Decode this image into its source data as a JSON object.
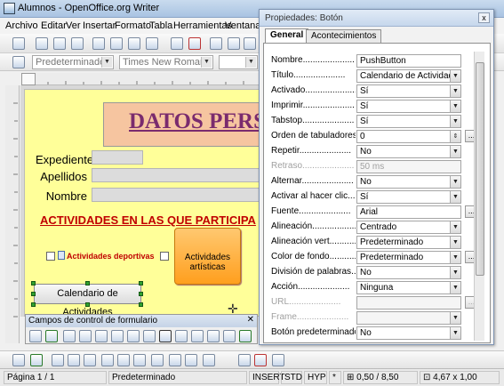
{
  "window": {
    "title": "Alumnos - OpenOffice.org Writer"
  },
  "menu": [
    "Archivo",
    "Editar",
    "Ver",
    "Insertar",
    "Formato",
    "Tabla",
    "Herramientas",
    "Ventana"
  ],
  "format_bar": {
    "style": "Predeterminado",
    "font": "Times New Roman"
  },
  "document": {
    "header": "DATOS PERSONA",
    "fields": [
      {
        "label": "Expediente"
      },
      {
        "label": "Apellidos"
      },
      {
        "label": "Nombre"
      }
    ],
    "activities_title": "ACTIVIDADES EN LAS QUE PARTICIPA",
    "checkbox_sport": "Actividades deportivas",
    "checkbox_art": "Actividades artísticas",
    "calendar_button": "Calendario de Actividades"
  },
  "form_controls_toolbar": {
    "title": "Campos de control de formulario"
  },
  "status_bar": {
    "page": "Página 1 / 1",
    "style": "Predeterminado",
    "insert": "INSERT",
    "std": "STD",
    "hyp": "HYP",
    "mod": "*",
    "position": "0,50 / 8,50",
    "size": "4,67 x 1,00"
  },
  "dialog": {
    "title": "Propiedades: Botón",
    "close": "x",
    "tabs": [
      "General",
      "Acontecimientos"
    ],
    "rows": [
      {
        "label": "Nombre",
        "value": "PushButton"
      },
      {
        "label": "Título",
        "value": "Calendario de Actividades"
      },
      {
        "label": "Activado",
        "value": "Sí"
      },
      {
        "label": "Imprimir",
        "value": "Sí"
      },
      {
        "label": "Tabstop",
        "value": "Sí"
      },
      {
        "label": "Orden de tabuladores",
        "value": "0"
      },
      {
        "label": "Repetir",
        "value": "No"
      },
      {
        "label": "Retraso",
        "value": "50 ms"
      },
      {
        "label": "Alternar",
        "value": "No"
      },
      {
        "label": "Activar al hacer clic",
        "value": "Sí"
      },
      {
        "label": "Fuente",
        "value": "Arial"
      },
      {
        "label": "Alineación",
        "value": "Centrado"
      },
      {
        "label": "Alineación vert.",
        "value": "Predeterminado"
      },
      {
        "label": "Color de fondo",
        "value": "Predeterminado"
      },
      {
        "label": "División de palabras",
        "value": "No"
      },
      {
        "label": "Acción",
        "value": "Ninguna"
      },
      {
        "label": "URL",
        "value": ""
      },
      {
        "label": "Frame",
        "value": ""
      },
      {
        "label": "Botón predeterminado",
        "value": "No"
      }
    ],
    "dots_label": "..."
  }
}
